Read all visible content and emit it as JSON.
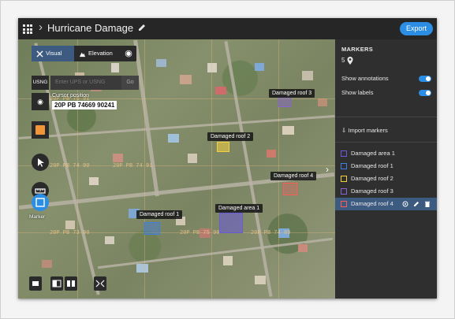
{
  "header": {
    "breadcrumb_chevron": "›",
    "title": "Hurricane Damage",
    "export_label": "Export"
  },
  "map": {
    "view_tabs": [
      {
        "label": "Visual",
        "active": true
      },
      {
        "label": "Elevation",
        "active": false
      }
    ],
    "coord_system_label": "USNG",
    "coord_input_placeholder": "Enter UPS or USNG",
    "go_label": "Go",
    "cursor_position_label": "Cursor position",
    "cursor_position_value": "20P PB 74669 90241",
    "tool_label": "Marker",
    "grid_labels": [
      "20P PB 75 91",
      "20P PB 74 91",
      "20P PB 74 90",
      "20P PB 75 90",
      "20P PB 73 90",
      "20P PB 74 89"
    ],
    "annotations": [
      {
        "label": "Damaged roof 3",
        "color": "#8a63d2"
      },
      {
        "label": "Damaged roof 2",
        "color": "#f4d03f"
      },
      {
        "label": "Damaged roof 4",
        "color": "#ff5a5a"
      },
      {
        "label": "Damaged roof 1",
        "color": "#3f7fe0"
      },
      {
        "label": "Damaged area 1",
        "color": "#6a5ad6"
      }
    ],
    "accent_color": "#f0953a"
  },
  "panel": {
    "title": "MARKERS",
    "marker_count": "5",
    "show_annotations_label": "Show annotations",
    "show_annotations_on": true,
    "show_labels_label": "Show labels",
    "show_labels_on": true,
    "import_label": "Import markers",
    "markers": [
      {
        "label": "Damaged area 1",
        "color": "#6a5ad6",
        "selected": false
      },
      {
        "label": "Damaged roof 1",
        "color": "#3f7fe0",
        "selected": false
      },
      {
        "label": "Damaged roof 2",
        "color": "#f4d03f",
        "selected": false
      },
      {
        "label": "Damaged roof 3",
        "color": "#8a63d2",
        "selected": false
      },
      {
        "label": "Damaged roof 4",
        "color": "#ff5a5a",
        "selected": true
      }
    ]
  },
  "colors": {
    "primary": "#2b8de3",
    "panel_bg": "#2f2f2f",
    "header_bg": "#262626"
  }
}
